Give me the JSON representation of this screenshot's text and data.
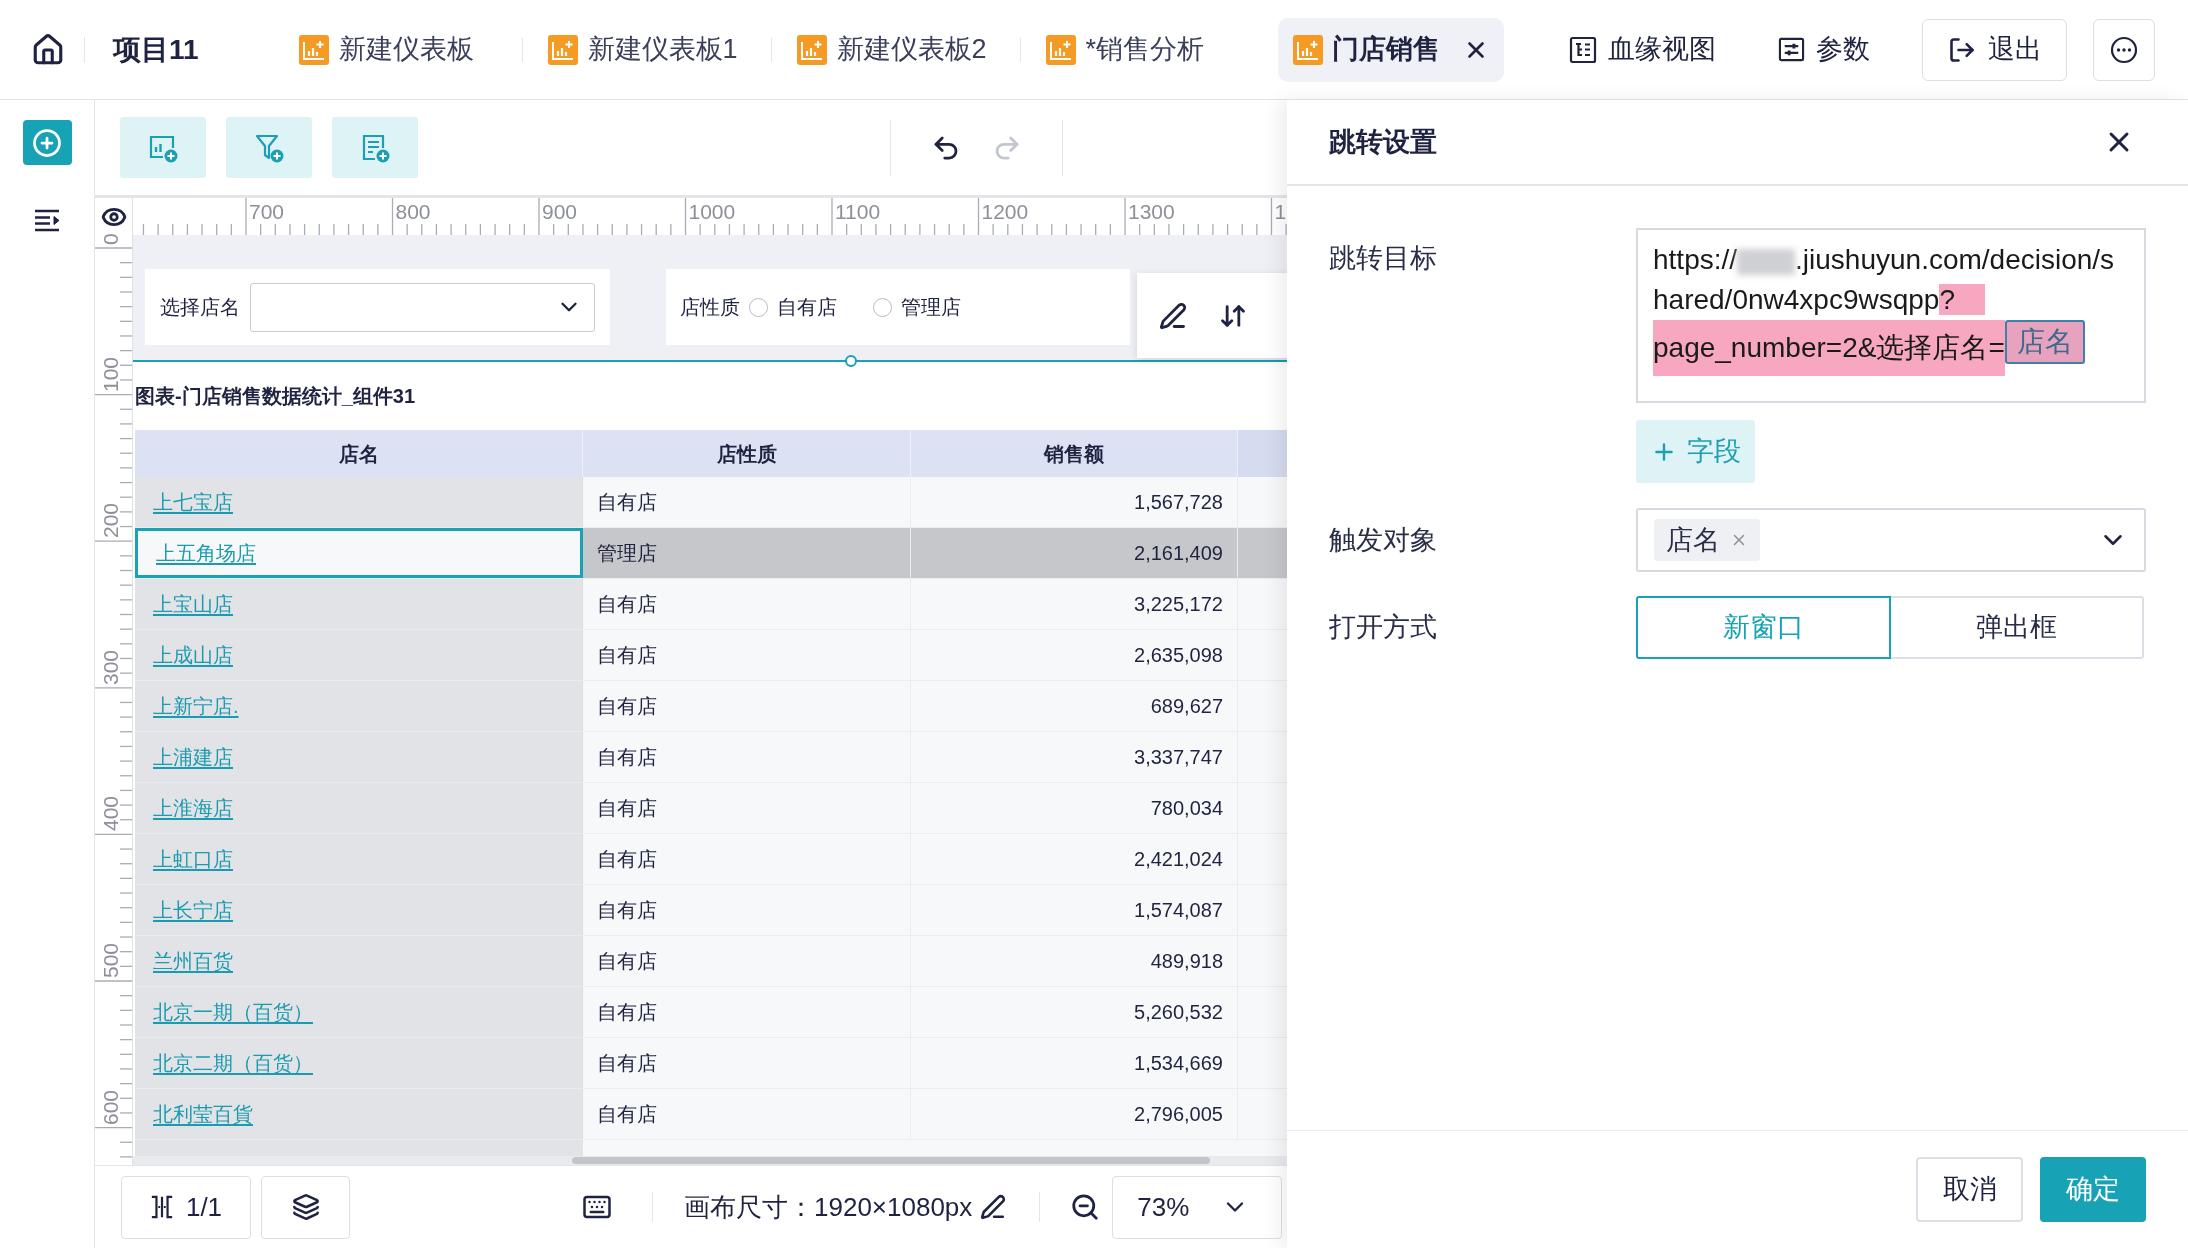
{
  "top_bar": {
    "project_title": "项目11",
    "tabs": [
      {
        "label": "新建仪表板",
        "selected": false
      },
      {
        "label": "新建仪表板1",
        "selected": false
      },
      {
        "label": "新建仪表板2",
        "selected": false
      },
      {
        "label": "*销售分析",
        "selected": false
      },
      {
        "label": "门店销售",
        "selected": true
      }
    ],
    "actions": [
      {
        "kind": "lineage",
        "label": "血缘视图"
      },
      {
        "kind": "parameters",
        "label": "参数"
      }
    ],
    "exit_button": "退出"
  },
  "toolbar": {
    "history": [
      {
        "kind": "undo",
        "disabled": false
      },
      {
        "kind": "redo",
        "disabled": true
      }
    ]
  },
  "ruler": {
    "x_labels": [
      "700",
      "800",
      "900",
      "1000",
      "1100",
      "1200",
      "1300",
      "1"
    ],
    "y_labels": [
      "0",
      "100",
      "200",
      "300",
      "400",
      "500",
      "600"
    ]
  },
  "canvas": {
    "filters": [
      {
        "kind": "select",
        "label": "选择店名"
      },
      {
        "kind": "radio",
        "label": "店性质",
        "options": [
          {
            "label": "自有店",
            "selected": false
          },
          {
            "label": "管理店",
            "selected": false
          }
        ]
      }
    ],
    "table_widget": {
      "title": "图表-门店销售数据统计_组件31",
      "columns": [
        "店名",
        "店性质",
        "销售额"
      ],
      "rows": [
        {
          "store": "上七宝店",
          "type": "自有店",
          "sales": "1,567,728",
          "selected": false
        },
        {
          "store": "上五角场店",
          "type": "管理店",
          "sales": "2,161,409",
          "selected": true
        },
        {
          "store": "上宝山店",
          "type": "自有店",
          "sales": "3,225,172",
          "selected": false
        },
        {
          "store": "上成山店",
          "type": "自有店",
          "sales": "2,635,098",
          "selected": false
        },
        {
          "store": "上新宁店.",
          "type": "自有店",
          "sales": "689,627",
          "selected": false
        },
        {
          "store": "上浦建店",
          "type": "自有店",
          "sales": "3,337,747",
          "selected": false
        },
        {
          "store": "上淮海店",
          "type": "自有店",
          "sales": "780,034",
          "selected": false
        },
        {
          "store": "上虹口店",
          "type": "自有店",
          "sales": "2,421,024",
          "selected": false
        },
        {
          "store": "上长宁店",
          "type": "自有店",
          "sales": "1,574,087",
          "selected": false
        },
        {
          "store": "兰州百货",
          "type": "自有店",
          "sales": "489,918",
          "selected": false
        },
        {
          "store": "北京一期（百货）",
          "type": "自有店",
          "sales": "5,260,532",
          "selected": false
        },
        {
          "store": "北京二期（百货）",
          "type": "自有店",
          "sales": "1,534,669",
          "selected": false
        },
        {
          "store": "北利莹百貨",
          "type": "自有店",
          "sales": "2,796,005",
          "selected": false
        }
      ]
    }
  },
  "canvas_footer": {
    "page_indicator": "1/1",
    "canvas_size": "画布尺寸：1920×1080px",
    "zoom": "73%"
  },
  "jump_settings": {
    "title": "跳转设置",
    "target": {
      "label": "跳转目标",
      "url_parts": [
        {
          "kind": "text",
          "text": "https://",
          "highlighted": false
        },
        {
          "kind": "redacted"
        },
        {
          "kind": "text",
          "text": ".jiushuyun.com/decision/shared/0nw4xpc9wsqpp",
          "highlighted": false
        },
        {
          "kind": "text",
          "text": "?",
          "highlighted": true
        },
        {
          "kind": "text",
          "text": "page_number=2&选择店名=",
          "highlighted": true
        },
        {
          "kind": "field",
          "text": "店名"
        }
      ]
    },
    "add_field_button": "字段",
    "trigger": {
      "label": "触发对象",
      "tags": [
        "店名"
      ]
    },
    "open_mode": {
      "label": "打开方式",
      "options": [
        {
          "label": "新窗口",
          "selected": true
        },
        {
          "label": "弹出框",
          "selected": false
        }
      ]
    },
    "cancel_button": "取消",
    "confirm_button": "确定"
  }
}
